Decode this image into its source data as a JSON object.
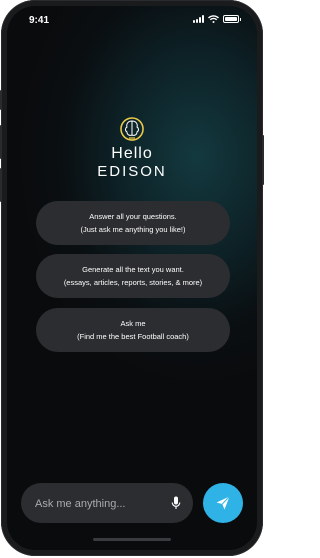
{
  "status_bar": {
    "time": "9:41"
  },
  "greeting": {
    "hello": "Hello",
    "brand": "EDISON"
  },
  "suggestions": [
    {
      "line1": "Answer all your questions.",
      "line2": "(Just ask me anything you like!)"
    },
    {
      "line1": "Generate all the text you want.",
      "line2": "(essays, articles, reports, stories, & more)"
    },
    {
      "line1": "Ask me",
      "line2": "(Find me the best Football coach)"
    }
  ],
  "composer": {
    "placeholder": "Ask me anything..."
  },
  "icons": {
    "logo": "brain-bulb-icon",
    "mic": "microphone-icon",
    "send": "send-icon",
    "signal": "signal-icon",
    "wifi": "wifi-icon",
    "battery": "battery-icon"
  },
  "colors": {
    "accent": "#2fb3e6",
    "logo_yellow": "#e8c94a",
    "card": "#2c2d30"
  }
}
